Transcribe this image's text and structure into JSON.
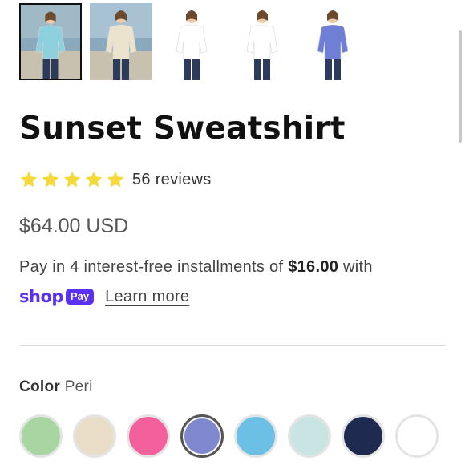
{
  "product": {
    "title": "Sunset Sweatshirt",
    "rating_stars": 5,
    "reviews_label": "56 reviews",
    "price": "$64.00 USD",
    "installments": {
      "prefix": "Pay in 4 interest-free installments of ",
      "amount": "$16.00",
      "suffix": " with"
    },
    "shop_pay": {
      "shop": "shop",
      "pay": "Pay",
      "learn_more": "Learn more"
    },
    "color": {
      "label": "Color",
      "selected": "Peri",
      "swatches": [
        {
          "name": "swatch-green",
          "hex": "#a8d5a2",
          "selected": false
        },
        {
          "name": "swatch-cream",
          "hex": "#eaddc8",
          "selected": false
        },
        {
          "name": "swatch-pink",
          "hex": "#f4609b",
          "selected": false
        },
        {
          "name": "swatch-peri",
          "hex": "#7f87cf",
          "selected": true
        },
        {
          "name": "swatch-sky-blue",
          "hex": "#6cc0e6",
          "selected": false
        },
        {
          "name": "swatch-light-aqua",
          "hex": "#c9e5e3",
          "selected": false
        },
        {
          "name": "swatch-navy",
          "hex": "#1e2a4f",
          "selected": false
        },
        {
          "name": "swatch-white",
          "hex": "#ffffff",
          "selected": false
        }
      ]
    }
  },
  "thumbnails": [
    {
      "name": "thumbnail-aqua-beach",
      "shirt": "#8fd0de",
      "bg": "#9fb9c6",
      "selected": true
    },
    {
      "name": "thumbnail-cream-beach",
      "shirt": "#ece3cf",
      "bg": "#a9c2d3",
      "selected": false
    },
    {
      "name": "thumbnail-white-front",
      "shirt": "#ffffff",
      "bg": "#ffffff",
      "selected": false
    },
    {
      "name": "thumbnail-white-back",
      "shirt": "#ffffff",
      "bg": "#ffffff",
      "selected": false
    },
    {
      "name": "thumbnail-peri-front",
      "shirt": "#6f7fd6",
      "bg": "#ffffff",
      "selected": false
    }
  ],
  "colors": {
    "shop_pay_purple": "#5a31f4",
    "star_yellow": "#f5d93a"
  }
}
